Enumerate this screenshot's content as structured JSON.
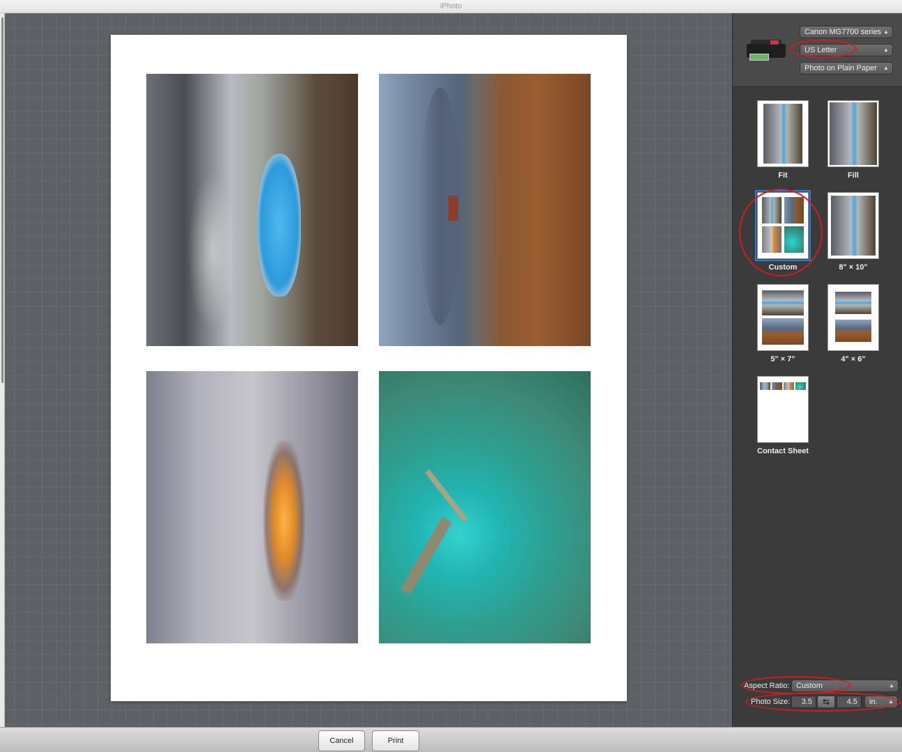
{
  "window": {
    "title": "iPhoto"
  },
  "printer": {
    "printer_name": "Canon MG7700 series",
    "paper_size": "US Letter",
    "paper_type": "Photo on Plain Paper"
  },
  "layouts": [
    {
      "label": "Fit",
      "icon": "fit-layout-thumbnail"
    },
    {
      "label": "Fill",
      "icon": "fill-layout-thumbnail"
    },
    {
      "label": "Custom",
      "icon": "custom-layout-thumbnail",
      "selected": true
    },
    {
      "label": "8\" × 10\"",
      "icon": "8x10-layout-thumbnail"
    },
    {
      "label": "5\" × 7\"",
      "icon": "5x7-layout-thumbnail"
    },
    {
      "label": "4\" × 6\"",
      "icon": "4x6-layout-thumbnail"
    },
    {
      "label": "Contact Sheet",
      "icon": "contact-sheet-layout-thumbnail"
    }
  ],
  "settings": {
    "aspect_ratio_label": "Aspect Ratio:",
    "aspect_ratio_value": "Custom",
    "photo_size_label": "Photo Size:",
    "photo_width": "3.5",
    "photo_height": "4.5",
    "unit": "in."
  },
  "buttons": {
    "cancel": "Cancel",
    "print": "Print"
  },
  "colors": {
    "annotation": "#d31d1d",
    "selection": "#2a7fe0"
  }
}
